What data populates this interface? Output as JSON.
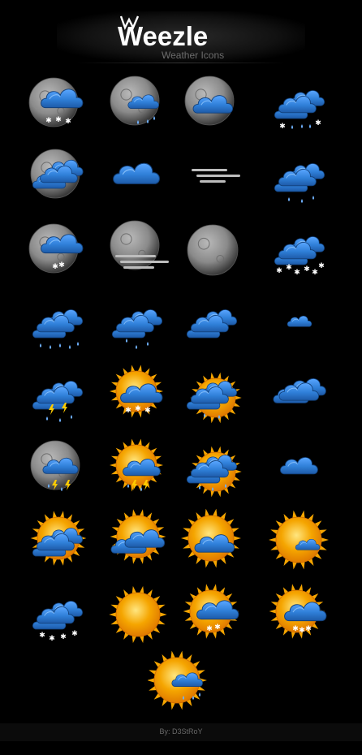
{
  "header": {
    "title": "Weezle",
    "subtitle": "Weather  Icons"
  },
  "footer": {
    "credit": "By:  D3StRoY"
  },
  "colors": {
    "cloud": "#2f7fd8",
    "cloud_dark": "#1d5aa8",
    "sun": "#f5a500",
    "moon": "#8a8a8a",
    "rain": "#6fb2ff",
    "snow": "#ffffff",
    "lightning": "#ffcc00",
    "fog": "#bdbdbd"
  },
  "icons": [
    [
      "moon-cloud-snow",
      "moon-cloud-rain",
      "moon-cloud",
      "clouds-snow-rain"
    ],
    [
      "moon-clouds",
      "cloud",
      "fog",
      "clouds-rain"
    ],
    [
      "moon-cloud-snow-light",
      "moon-fog",
      "moon",
      "clouds-heavy-snow"
    ],
    [
      "clouds-heavy-rain",
      "clouds-rain-light",
      "clouds-overcast",
      "cloud-small"
    ],
    [
      "clouds-thunderstorm",
      "sun-cloud-snow",
      "sun-clouds-sleet",
      "clouds-partly"
    ],
    [
      "moon-cloud-thunder",
      "sun-cloud-thunder",
      "sun-clouds-sleet-heavy",
      "cloud-single"
    ],
    [
      "sun-clouds-heavy",
      "sun-clouds",
      "sun-cloud",
      "sun-cloud-small"
    ],
    [
      "clouds-snow",
      "sun",
      "sun-cloud-snow-light",
      "sun-cloud-snow-heavy"
    ],
    [
      "sun-cloud-rain"
    ]
  ]
}
